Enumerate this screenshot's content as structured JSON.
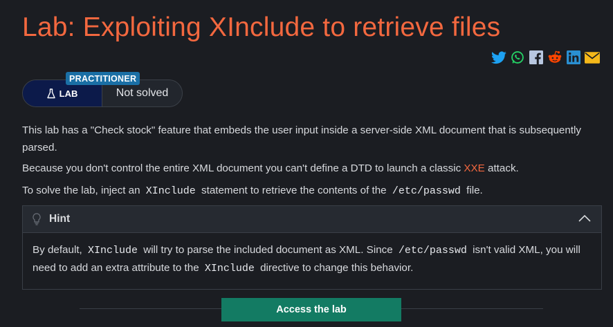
{
  "title": "Lab: Exploiting XInclude to retrieve files",
  "share_icons": [
    "twitter-icon",
    "whatsapp-icon",
    "facebook-icon",
    "reddit-icon",
    "linkedin-icon",
    "email-icon"
  ],
  "badge": {
    "level": "PRACTITIONER",
    "lab": "LAB",
    "status": "Not solved"
  },
  "description": {
    "p1": "This lab has a \"Check stock\" feature that embeds the user input inside a server-side XML document that is subsequently parsed.",
    "p2_before": "Because you don't control the entire XML document you can't define a DTD to launch a classic ",
    "p2_link": "XXE",
    "p2_after": " attack.",
    "p3_before": "To solve the lab, inject an ",
    "p3_code1": "XInclude",
    "p3_middle": " statement to retrieve the contents of the ",
    "p3_code2": "/etc/passwd",
    "p3_after": " file."
  },
  "hint": {
    "label": "Hint",
    "t1": "By default, ",
    "c1": "XInclude",
    "t2": " will try to parse the included document as XML. Since ",
    "c2": "/etc/passwd",
    "t3": " isn't valid XML, you will need to add an extra attribute to the ",
    "c3": "XInclude",
    "t4": " directive to change this behavior."
  },
  "access_button": "Access the lab",
  "colors": {
    "accent": "#f3683f",
    "button": "#137b63",
    "badge": "#1a6fa5",
    "lab_bg": "#0c1a4a"
  }
}
